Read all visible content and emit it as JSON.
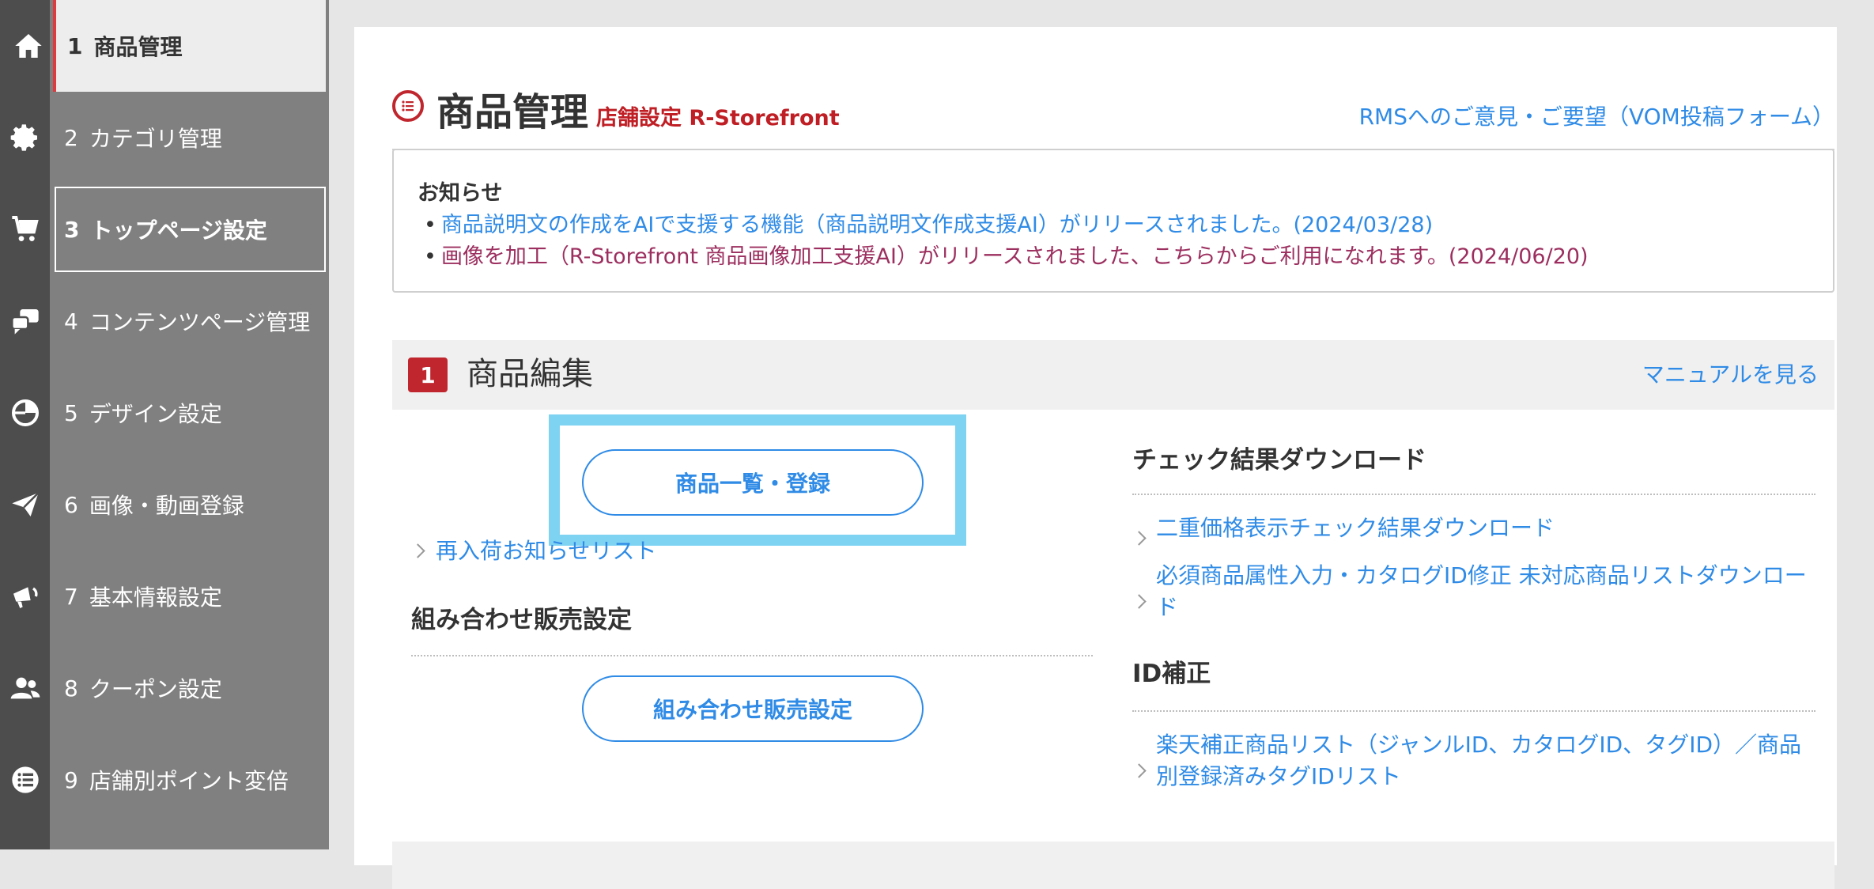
{
  "sidebar": {
    "items": [
      {
        "num": "1",
        "label": "商品管理",
        "icon": "home-icon"
      },
      {
        "num": "2",
        "label": "カテゴリ管理",
        "icon": "gear-icon"
      },
      {
        "num": "3",
        "label": "トップページ設定",
        "icon": "cart-icon"
      },
      {
        "num": "4",
        "label": "コンテンツページ管理",
        "icon": "chat-bubbles-icon"
      },
      {
        "num": "5",
        "label": "デザイン設定",
        "icon": "pie-chart-icon"
      },
      {
        "num": "6",
        "label": "画像・動画登録",
        "icon": "paper-plane-icon"
      },
      {
        "num": "7",
        "label": "基本情報設定",
        "icon": "megaphone-icon"
      },
      {
        "num": "8",
        "label": "クーポン設定",
        "icon": "users-icon"
      },
      {
        "num": "9",
        "label": "店舗別ポイント変倍",
        "icon": "list-icon"
      }
    ]
  },
  "header": {
    "title": "商品管理",
    "subtitle": "店舗設定 R-Storefront",
    "feedback_link": "RMSへのご意見・ご要望（VOM投稿フォーム）"
  },
  "notice": {
    "title": "お知らせ",
    "bullet": "•",
    "items": [
      "商品説明文の作成をAIで支援する機能（商品説明文作成支援AI）がリリースされました。(2024/03/28)",
      "画像を加工（R-Storefront 商品画像加工支援AI）がリリースされました、こちらからご利用になれます。(2024/06/20)"
    ]
  },
  "section": {
    "number": "1",
    "title": "商品編集",
    "manual_link": "マニュアルを見る"
  },
  "left_col": {
    "product_list_button": "商品一覧・登録",
    "restock_link": "再入荷お知らせリスト",
    "combo_heading": "組み合わせ販売設定",
    "combo_button": "組み合わせ販売設定"
  },
  "right_col": {
    "check_heading": "チェック結果ダウンロード",
    "check_links": [
      "二重価格表示チェック結果ダウンロード",
      "必須商品属性入力・カタログID修正 未対応商品リストダウンロード"
    ],
    "id_heading": "ID補正",
    "id_link": "楽天補正商品リスト（ジャンルID、カタログID、タグID）／商品別登録済みタグIDリスト"
  },
  "colors": {
    "accent_red": "#c0262d",
    "link_blue": "#2f8be6",
    "highlight": "#7fd3f2",
    "sidebar": "#808080"
  }
}
